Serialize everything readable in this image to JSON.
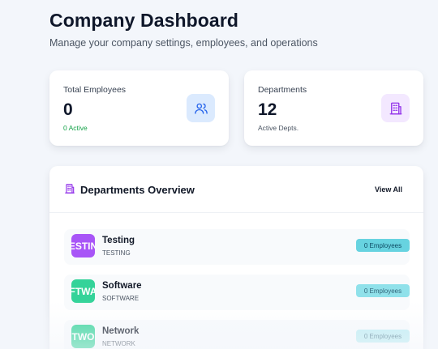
{
  "header": {
    "title": "Company Dashboard",
    "subtitle": "Manage your company settings, employees, and operations"
  },
  "stats": [
    {
      "label": "Total Employees",
      "value": "0",
      "sub": "0 Active",
      "icon": "users-icon",
      "sub_color": "#16a34a",
      "icon_bg": "#dbeafe"
    },
    {
      "label": "Departments",
      "value": "12",
      "sub": "Active Depts.",
      "icon": "building-icon",
      "sub_color": "#4b5563",
      "icon_bg": "#f3e8ff"
    }
  ],
  "overview": {
    "title": "Departments Overview",
    "icon": "building-icon",
    "view_all": "View All",
    "departments": [
      {
        "avatar_text": "ESTIN",
        "name": "Testing",
        "code": "TESTING",
        "count": "0 Employees",
        "avatar_color": "#a855f7",
        "badge_color": "#67d3e0"
      },
      {
        "avatar_text": "FTWA",
        "name": "Software",
        "code": "SOFTWARE",
        "count": "0 Employees",
        "avatar_color": "#34d399",
        "badge_color": "#7fdde8"
      },
      {
        "avatar_text": "TWO",
        "name": "Network",
        "code": "NETWORK",
        "count": "0 Employees",
        "avatar_color": "#34d399",
        "badge_color": "#a6e8f0"
      }
    ]
  }
}
